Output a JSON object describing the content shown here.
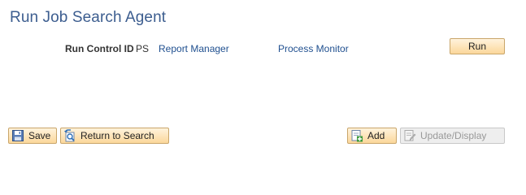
{
  "page": {
    "title": "Run Job Search Agent"
  },
  "run_control": {
    "label": "Run Control ID",
    "value": "PS"
  },
  "links": {
    "report_manager": "Report Manager",
    "process_monitor": "Process Monitor"
  },
  "buttons": {
    "run": "Run",
    "save": "Save",
    "return_to_search": "Return to Search",
    "add": "Add",
    "update_display": "Update/Display"
  },
  "icons": {
    "save": "save-icon",
    "return_to_search": "return-to-search-icon",
    "add": "add-icon",
    "update_display": "update-display-icon"
  },
  "colors": {
    "title": "#3c5d8f",
    "link": "#1f4f8f",
    "button_border": "#c9a66a",
    "button_fill": "#fbd79b",
    "disabled_text": "#999999"
  }
}
